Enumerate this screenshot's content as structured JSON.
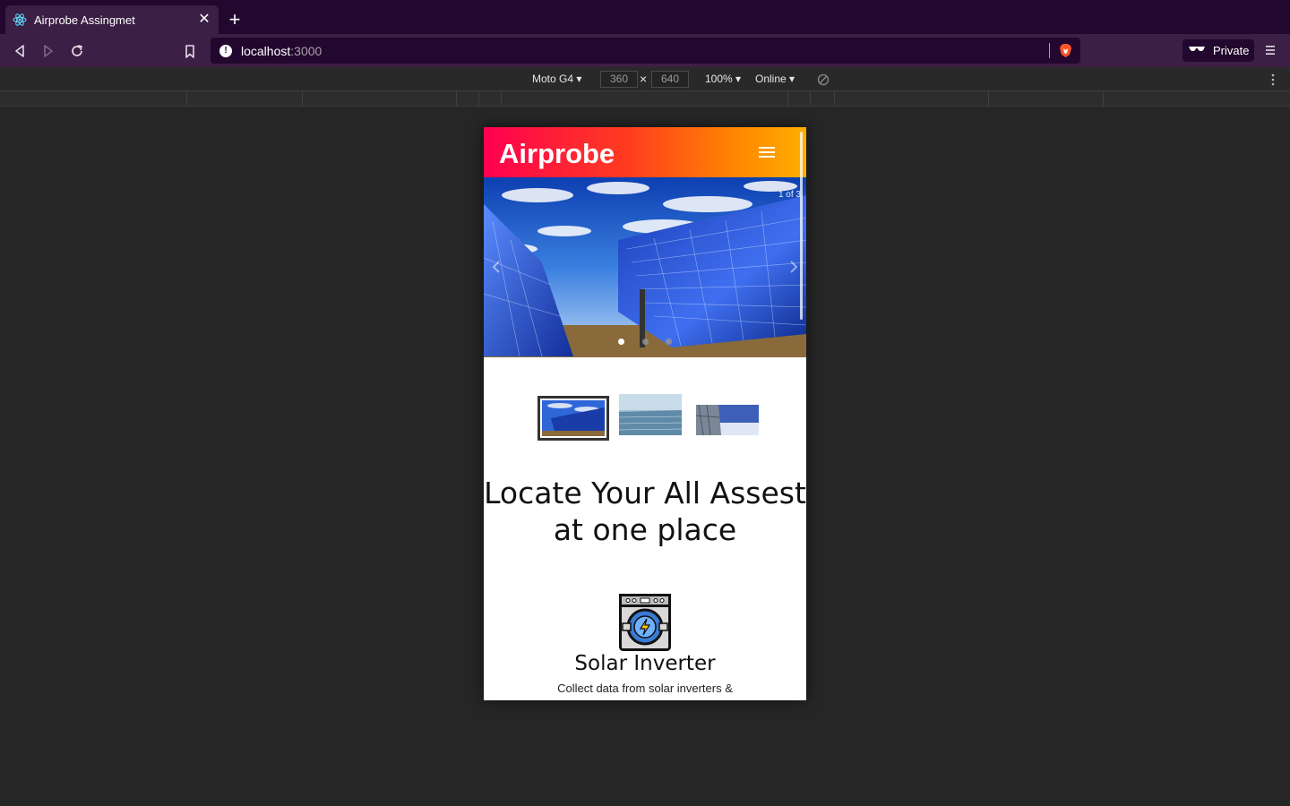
{
  "browser": {
    "tab": {
      "title": "Airprobe Assingmet",
      "favicon_icon": "react-icon"
    },
    "new_tab_label": "+",
    "url": {
      "host": "localhost",
      "port": ":3000"
    },
    "private_label": "Private"
  },
  "devtools": {
    "device": "Moto G4 ▾",
    "width": "360",
    "height": "640",
    "times": "×",
    "zoom": "100% ▾",
    "network": "Online ▾"
  },
  "app": {
    "brand": "Airprobe",
    "carousel": {
      "counter": "1 of 3",
      "slide_count": 3,
      "active_slide": 1
    },
    "headline": [
      "Locate Your All Assest",
      "at one place"
    ],
    "feature": {
      "title": "Solar Inverter",
      "description": "Collect data from solar inverters &",
      "icon": "solar-inverter-icon"
    }
  },
  "colors": {
    "appbar_gradient": [
      "#ff0050",
      "#ff8a00",
      "#ffae00"
    ],
    "browser_chrome": "#3b1f44",
    "tabstrip": "#22082e"
  }
}
